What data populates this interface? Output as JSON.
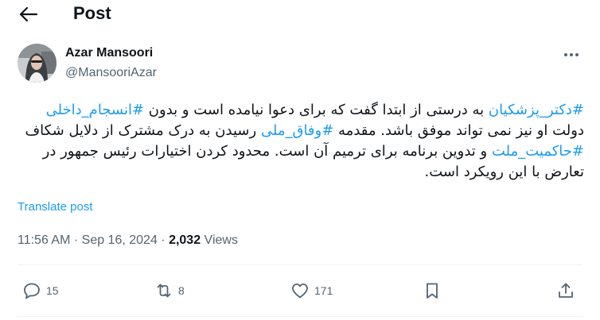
{
  "header": {
    "title": "Post"
  },
  "author": {
    "name": "Azar Mansoori",
    "handle": "@MansooriAzar"
  },
  "tweet": {
    "segments": [
      {
        "text": "#دکتر_پزشکیان",
        "hashtag": true
      },
      {
        "text": " به درستی از ابتدا گفت که برای دعوا نیامده است و بدون ",
        "hashtag": false
      },
      {
        "text": "#انسجام_داخلی",
        "hashtag": true
      },
      {
        "text": " دولت او نیز نمی تواند موفق باشد. مقدمه ",
        "hashtag": false
      },
      {
        "text": "#وفاق_ملی",
        "hashtag": true
      },
      {
        "text": " رسیدن به درک مشترک از دلایل شکاف ",
        "hashtag": false
      },
      {
        "text": "#حاکمیت_ملت",
        "hashtag": true
      },
      {
        "text": " و تدوین برنامه برای ترمیم آن است. محدود کردن اختیارات رئیس جمهور در تعارض با این رویکرد است.",
        "hashtag": false
      }
    ]
  },
  "translate": {
    "label": "Translate post"
  },
  "meta": {
    "time": "11:56 AM",
    "sep1": " · ",
    "date": "Sep 16, 2024",
    "sep2": " · ",
    "views": "2,032",
    "views_label": " Views"
  },
  "actions": {
    "replies": "15",
    "reposts": "8",
    "likes": "171"
  },
  "colors": {
    "accent": "#1d9bf0",
    "text": "#0f1419",
    "muted": "#536471"
  }
}
